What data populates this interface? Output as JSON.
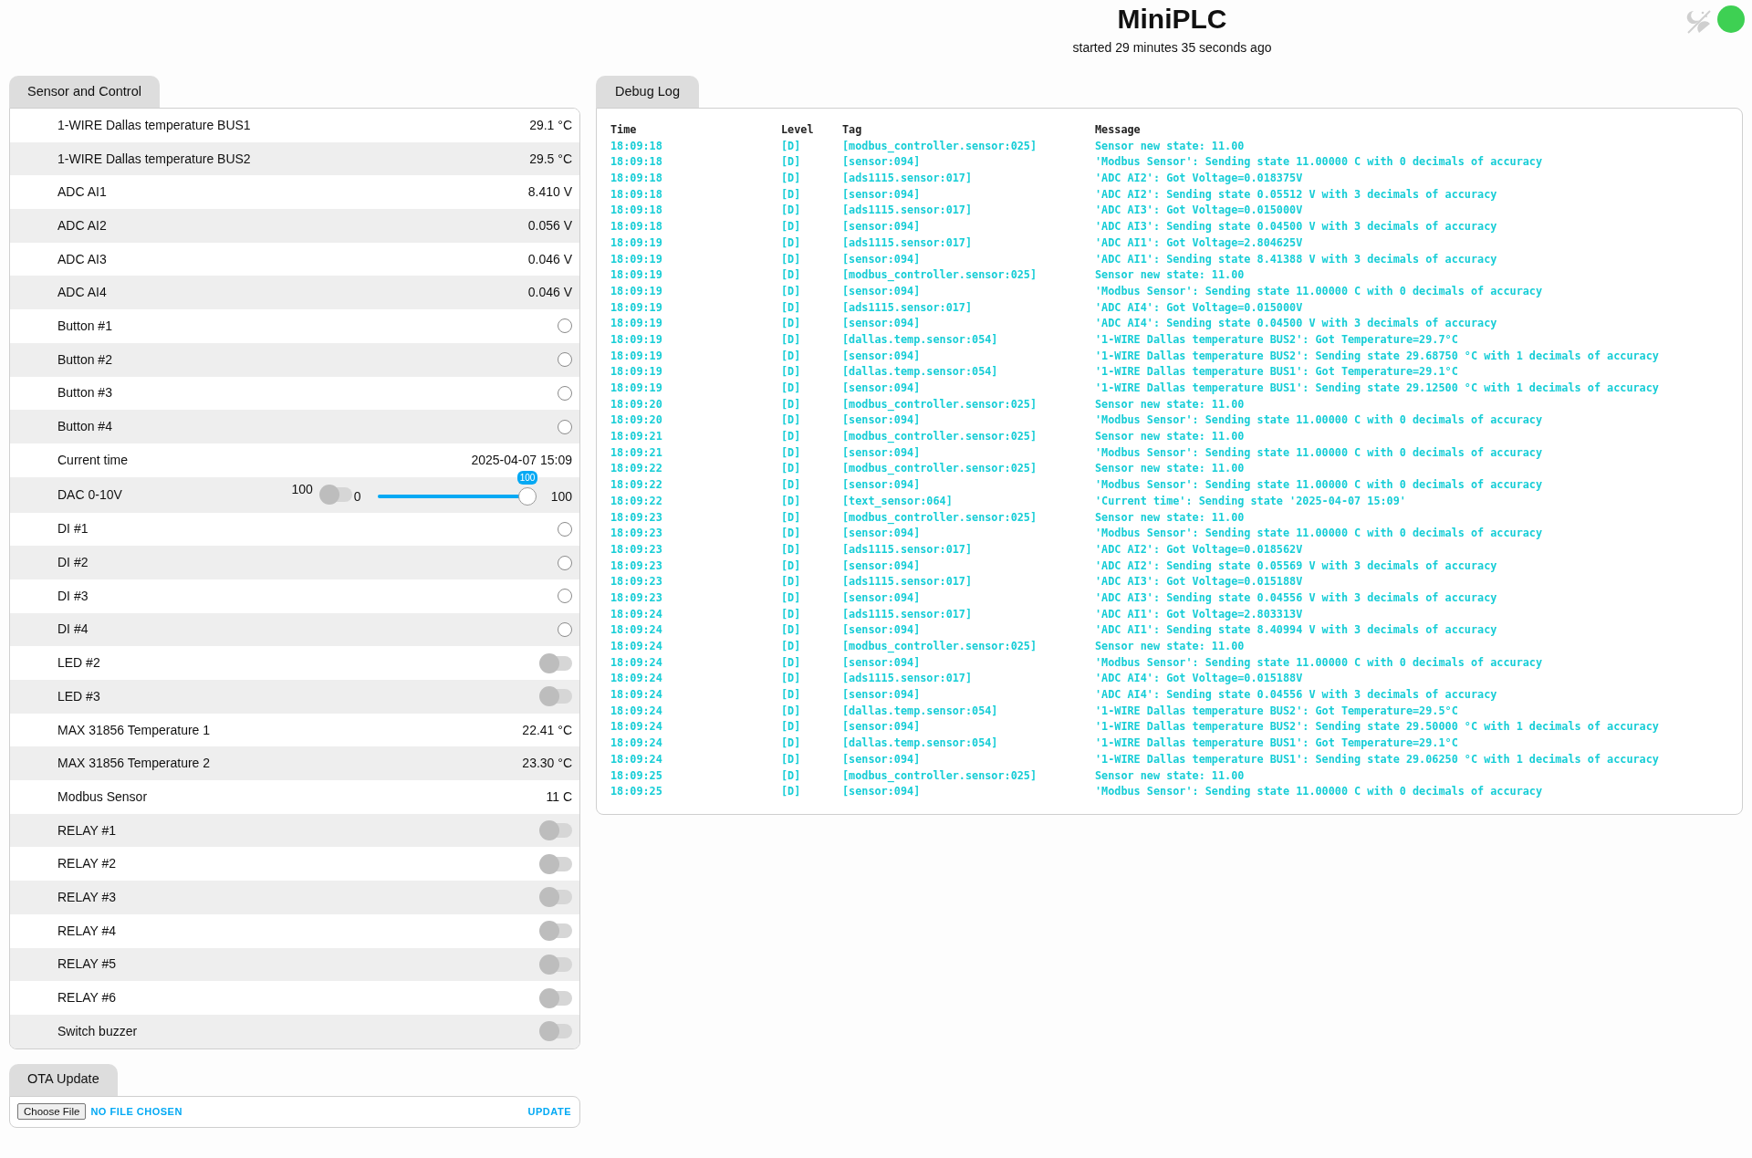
{
  "header": {
    "title": "MiniPLC",
    "subtitle": "started 29 minutes 35 seconds ago"
  },
  "sensor_panel": {
    "tab": "Sensor and Control",
    "rows": [
      {
        "kind": "value",
        "name": "1-WIRE Dallas temperature BUS1",
        "value": "29.1 °C"
      },
      {
        "kind": "value",
        "name": "1-WIRE Dallas temperature BUS2",
        "value": "29.5 °C"
      },
      {
        "kind": "value",
        "name": "ADC AI1",
        "value": "8.410 V"
      },
      {
        "kind": "value",
        "name": "ADC AI2",
        "value": "0.056 V"
      },
      {
        "kind": "value",
        "name": "ADC AI3",
        "value": "0.046 V"
      },
      {
        "kind": "value",
        "name": "ADC AI4",
        "value": "0.046 V"
      },
      {
        "kind": "binary",
        "name": "Button #1",
        "on": false
      },
      {
        "kind": "binary",
        "name": "Button #2",
        "on": false
      },
      {
        "kind": "binary",
        "name": "Button #3",
        "on": false
      },
      {
        "kind": "binary",
        "name": "Button #4",
        "on": false
      },
      {
        "kind": "value",
        "name": "Current time",
        "value": "2025-04-07 15:09"
      },
      {
        "kind": "slider",
        "name": "DAC 0-10V",
        "value": "100",
        "switch_on": false,
        "min": "0",
        "max": "100",
        "bubble": "100",
        "level": 1
      },
      {
        "kind": "binary",
        "name": "DI #1",
        "on": false
      },
      {
        "kind": "binary",
        "name": "DI #2",
        "on": false
      },
      {
        "kind": "binary",
        "name": "DI #3",
        "on": false
      },
      {
        "kind": "binary",
        "name": "DI #4",
        "on": false
      },
      {
        "kind": "switch",
        "name": "LED #2",
        "on": false
      },
      {
        "kind": "switch",
        "name": "LED #3",
        "on": false
      },
      {
        "kind": "value",
        "name": "MAX 31856 Temperature 1",
        "value": "22.41 °C"
      },
      {
        "kind": "value",
        "name": "MAX 31856 Temperature 2",
        "value": "23.30 °C"
      },
      {
        "kind": "value",
        "name": "Modbus Sensor",
        "value": "11 C"
      },
      {
        "kind": "switch",
        "name": "RELAY #1",
        "on": false
      },
      {
        "kind": "switch",
        "name": "RELAY #2",
        "on": false
      },
      {
        "kind": "switch",
        "name": "RELAY #3",
        "on": false
      },
      {
        "kind": "switch",
        "name": "RELAY #4",
        "on": false
      },
      {
        "kind": "switch",
        "name": "RELAY #5",
        "on": false
      },
      {
        "kind": "switch",
        "name": "RELAY #6",
        "on": false
      },
      {
        "kind": "switch",
        "name": "Switch buzzer",
        "on": false
      }
    ]
  },
  "ota_panel": {
    "tab": "OTA Update",
    "choose_button": "Choose File",
    "file_status": "NO FILE CHOSEN",
    "update_button": "UPDATE"
  },
  "debug_log": {
    "tab": "Debug Log",
    "columns": [
      "Time",
      "Level",
      "Tag",
      "Message"
    ],
    "rows": [
      [
        "18:09:18",
        "[D]",
        "[modbus_controller.sensor:025]",
        "Sensor new state: 11.00"
      ],
      [
        "18:09:18",
        "[D]",
        "[sensor:094]",
        "'Modbus Sensor': Sending state 11.00000 C with 0 decimals of accuracy"
      ],
      [
        "18:09:18",
        "[D]",
        "[ads1115.sensor:017]",
        "'ADC AI2': Got Voltage=0.018375V"
      ],
      [
        "18:09:18",
        "[D]",
        "[sensor:094]",
        "'ADC AI2': Sending state 0.05512 V with 3 decimals of accuracy"
      ],
      [
        "18:09:18",
        "[D]",
        "[ads1115.sensor:017]",
        "'ADC AI3': Got Voltage=0.015000V"
      ],
      [
        "18:09:18",
        "[D]",
        "[sensor:094]",
        "'ADC AI3': Sending state 0.04500 V with 3 decimals of accuracy"
      ],
      [
        "18:09:19",
        "[D]",
        "[ads1115.sensor:017]",
        "'ADC AI1': Got Voltage=2.804625V"
      ],
      [
        "18:09:19",
        "[D]",
        "[sensor:094]",
        "'ADC AI1': Sending state 8.41388 V with 3 decimals of accuracy"
      ],
      [
        "18:09:19",
        "[D]",
        "[modbus_controller.sensor:025]",
        "Sensor new state: 11.00"
      ],
      [
        "18:09:19",
        "[D]",
        "[sensor:094]",
        "'Modbus Sensor': Sending state 11.00000 C with 0 decimals of accuracy"
      ],
      [
        "18:09:19",
        "[D]",
        "[ads1115.sensor:017]",
        "'ADC AI4': Got Voltage=0.015000V"
      ],
      [
        "18:09:19",
        "[D]",
        "[sensor:094]",
        "'ADC AI4': Sending state 0.04500 V with 3 decimals of accuracy"
      ],
      [
        "18:09:19",
        "[D]",
        "[dallas.temp.sensor:054]",
        "'1-WIRE Dallas temperature BUS2': Got Temperature=29.7°C"
      ],
      [
        "18:09:19",
        "[D]",
        "[sensor:094]",
        "'1-WIRE Dallas temperature BUS2': Sending state 29.68750 °C with 1 decimals of accuracy"
      ],
      [
        "18:09:19",
        "[D]",
        "[dallas.temp.sensor:054]",
        "'1-WIRE Dallas temperature BUS1': Got Temperature=29.1°C"
      ],
      [
        "18:09:19",
        "[D]",
        "[sensor:094]",
        "'1-WIRE Dallas temperature BUS1': Sending state 29.12500 °C with 1 decimals of accuracy"
      ],
      [
        "18:09:20",
        "[D]",
        "[modbus_controller.sensor:025]",
        "Sensor new state: 11.00"
      ],
      [
        "18:09:20",
        "[D]",
        "[sensor:094]",
        "'Modbus Sensor': Sending state 11.00000 C with 0 decimals of accuracy"
      ],
      [
        "18:09:21",
        "[D]",
        "[modbus_controller.sensor:025]",
        "Sensor new state: 11.00"
      ],
      [
        "18:09:21",
        "[D]",
        "[sensor:094]",
        "'Modbus Sensor': Sending state 11.00000 C with 0 decimals of accuracy"
      ],
      [
        "18:09:22",
        "[D]",
        "[modbus_controller.sensor:025]",
        "Sensor new state: 11.00"
      ],
      [
        "18:09:22",
        "[D]",
        "[sensor:094]",
        "'Modbus Sensor': Sending state 11.00000 C with 0 decimals of accuracy"
      ],
      [
        "18:09:22",
        "[D]",
        "[text_sensor:064]",
        "'Current time': Sending state '2025-04-07 15:09'"
      ],
      [
        "18:09:23",
        "[D]",
        "[modbus_controller.sensor:025]",
        "Sensor new state: 11.00"
      ],
      [
        "18:09:23",
        "[D]",
        "[sensor:094]",
        "'Modbus Sensor': Sending state 11.00000 C with 0 decimals of accuracy"
      ],
      [
        "18:09:23",
        "[D]",
        "[ads1115.sensor:017]",
        "'ADC AI2': Got Voltage=0.018562V"
      ],
      [
        "18:09:23",
        "[D]",
        "[sensor:094]",
        "'ADC AI2': Sending state 0.05569 V with 3 decimals of accuracy"
      ],
      [
        "18:09:23",
        "[D]",
        "[ads1115.sensor:017]",
        "'ADC AI3': Got Voltage=0.015188V"
      ],
      [
        "18:09:23",
        "[D]",
        "[sensor:094]",
        "'ADC AI3': Sending state 0.04556 V with 3 decimals of accuracy"
      ],
      [
        "18:09:24",
        "[D]",
        "[ads1115.sensor:017]",
        "'ADC AI1': Got Voltage=2.803313V"
      ],
      [
        "18:09:24",
        "[D]",
        "[sensor:094]",
        "'ADC AI1': Sending state 8.40994 V with 3 decimals of accuracy"
      ],
      [
        "18:09:24",
        "[D]",
        "[modbus_controller.sensor:025]",
        "Sensor new state: 11.00"
      ],
      [
        "18:09:24",
        "[D]",
        "[sensor:094]",
        "'Modbus Sensor': Sending state 11.00000 C with 0 decimals of accuracy"
      ],
      [
        "18:09:24",
        "[D]",
        "[ads1115.sensor:017]",
        "'ADC AI4': Got Voltage=0.015188V"
      ],
      [
        "18:09:24",
        "[D]",
        "[sensor:094]",
        "'ADC AI4': Sending state 0.04556 V with 3 decimals of accuracy"
      ],
      [
        "18:09:24",
        "[D]",
        "[dallas.temp.sensor:054]",
        "'1-WIRE Dallas temperature BUS2': Got Temperature=29.5°C"
      ],
      [
        "18:09:24",
        "[D]",
        "[sensor:094]",
        "'1-WIRE Dallas temperature BUS2': Sending state 29.50000 °C with 1 decimals of accuracy"
      ],
      [
        "18:09:24",
        "[D]",
        "[dallas.temp.sensor:054]",
        "'1-WIRE Dallas temperature BUS1': Got Temperature=29.1°C"
      ],
      [
        "18:09:24",
        "[D]",
        "[sensor:094]",
        "'1-WIRE Dallas temperature BUS1': Sending state 29.06250 °C with 1 decimals of accuracy"
      ],
      [
        "18:09:25",
        "[D]",
        "[modbus_controller.sensor:025]",
        "Sensor new state: 11.00"
      ],
      [
        "18:09:25",
        "[D]",
        "[sensor:094]",
        "'Modbus Sensor': Sending state 11.00000 C with 0 decimals of accuracy"
      ]
    ]
  }
}
